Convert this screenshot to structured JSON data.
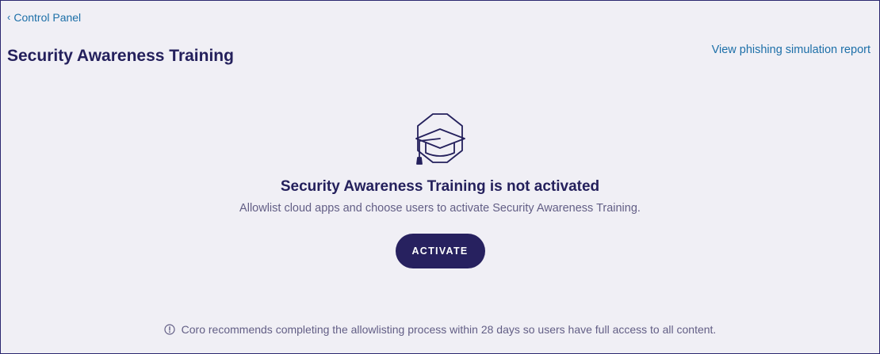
{
  "nav": {
    "back_chevron": "‹",
    "back_label": "Control Panel"
  },
  "header": {
    "title": "Security Awareness Training",
    "report_link": "View phishing simulation report"
  },
  "empty_state": {
    "icon": "graduation-cap-icon",
    "title": "Security Awareness Training is not activated",
    "subtitle": "Allowlist cloud apps and choose users to activate Security Awareness Training.",
    "button_label": "ACTIVATE"
  },
  "footer": {
    "icon": "info-icon",
    "note": "Coro recommends completing the allowlisting process within 28 days so users have full access to all content."
  },
  "colors": {
    "background": "#f0eff5",
    "primary": "#27215f",
    "link": "#1c6fa8",
    "muted_text": "#625e85"
  }
}
